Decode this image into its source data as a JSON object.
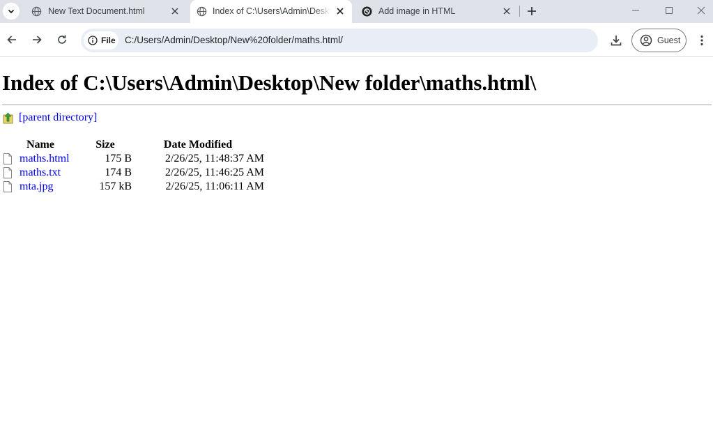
{
  "tabs": [
    {
      "title": "New Text Document.html",
      "active": false,
      "icon": "globe-icon"
    },
    {
      "title": "Index of C:\\Users\\Admin\\Desktop\\New folder\\maths.html\\",
      "active": true,
      "icon": "globe-icon"
    },
    {
      "title": "Add image in HTML",
      "active": false,
      "icon": "chatgpt-icon"
    }
  ],
  "toolbar": {
    "scheme_label": "File",
    "url": "C:/Users/Admin/Desktop/New%20folder/maths.html/",
    "profile_label": "Guest"
  },
  "page": {
    "heading": "Index of C:\\Users\\Admin\\Desktop\\New folder\\maths.html\\",
    "parent_link": "[parent directory]",
    "columns": {
      "name": "Name",
      "size": "Size",
      "date": "Date Modified"
    },
    "files": [
      {
        "name": "maths.html",
        "size": "175 B",
        "date": "2/26/25, 11:48:37 AM"
      },
      {
        "name": "maths.txt",
        "size": "174 B",
        "date": "2/26/25, 11:46:25 AM"
      },
      {
        "name": "mta.jpg",
        "size": "157 kB",
        "date": "2/26/25, 11:06:11 AM"
      }
    ]
  },
  "colors": {
    "tabstrip_bg": "#dfe3e9",
    "omnibox_bg": "#e9eef6",
    "link": "#0000ee"
  }
}
